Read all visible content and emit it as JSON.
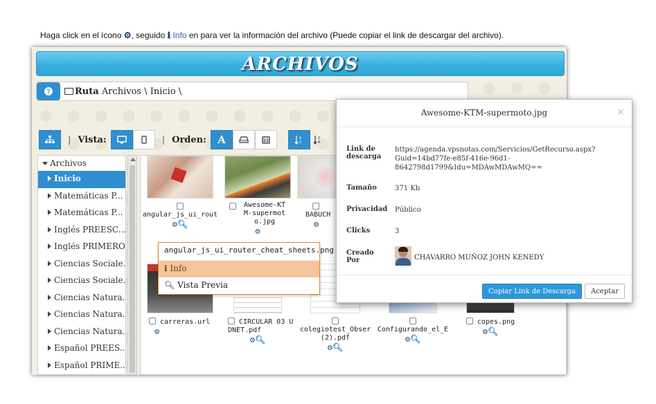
{
  "instruction": {
    "part1": "Haga click en el ícono",
    "part2": ", seguido",
    "info_label": "Info",
    "part3": "en para ver la información del archivo (Puede copiar el link de descargar del archivo)."
  },
  "banner": {
    "title": "ARCHIVOS"
  },
  "path": {
    "label": "Ruta",
    "value": "Archivos \\ Inicio \\"
  },
  "toolbar": {
    "vista_label": "Vista:",
    "orden_label": "Orden:",
    "sort_alpha_label": "A"
  },
  "tree": {
    "root": "Archivos",
    "items": [
      {
        "label": "Inicio",
        "active": true
      },
      {
        "label": "Matemáticas P..."
      },
      {
        "label": "Matemáticas P..."
      },
      {
        "label": "Inglés PREESC..."
      },
      {
        "label": "Inglés PRIMERO"
      },
      {
        "label": "Ciencias Sociale..."
      },
      {
        "label": "Ciencias Sociale..."
      },
      {
        "label": "Ciencias Natura..."
      },
      {
        "label": "Ciencias Natura..."
      },
      {
        "label": "Ciencias Natura..."
      },
      {
        "label": "Español PREES..."
      },
      {
        "label": "Español PRIME..."
      }
    ]
  },
  "files": [
    {
      "name": "angular_js_ui_rout"
    },
    {
      "name": "Awesome-KTM-supermoto.jpg"
    },
    {
      "name": "BABUCH"
    },
    {
      "name": "carreras.url"
    },
    {
      "name": "CIRCULAR 03 UDNET.pdf"
    },
    {
      "name": "colegiotest_Obser (2).pdf"
    },
    {
      "name": "Configurando_el_E"
    },
    {
      "name": "copes.png"
    }
  ],
  "context_menu": {
    "title": "angular_js_ui_router_cheat_sheets.png",
    "info": "Info",
    "preview": "Vista Previa"
  },
  "modal": {
    "title": "Awesome-KTM-supermoto.jpg",
    "close": "×",
    "link_label": "Link de descarga",
    "link_line1": "https://agenda.vpsnotas.com/Servicios/GetRecurso.aspx?",
    "link_line2": "Guid=14bd77fe-e85f-416e-96d1-",
    "link_line3": "8642798d1799&Idu=MDAwMDAwMQ==",
    "size_label": "Tamaño",
    "size_value": "371 Kb",
    "privacy_label": "Privacidad",
    "privacy_value": "Público",
    "clicks_label": "Clicks",
    "clicks_value": "3",
    "creator_label": "Creado Por",
    "creator_value": "CHAVARRO MUÑOZ JOHN KENEDY",
    "copy_button": "Copiar Link de Descarga",
    "accept_button": "Aceptar"
  },
  "colors": {
    "accent": "#2f8fd0",
    "banner": "#3ab1e0",
    "context_highlight": "#f6c49a",
    "context_border": "#e08a2b"
  }
}
